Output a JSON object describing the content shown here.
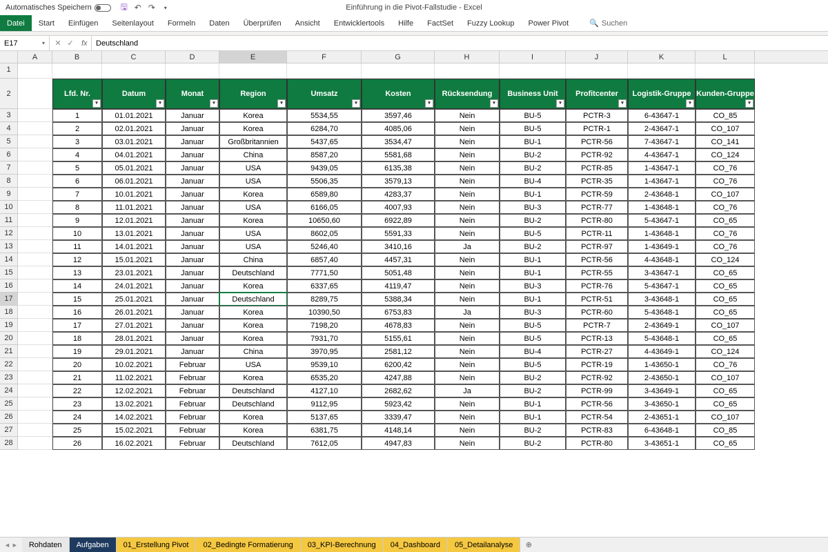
{
  "titlebar": {
    "autosave_label": "Automatisches Speichern",
    "doc_title": "Einführung in die Pivot-Fallstudie - Excel"
  },
  "ribbon": {
    "tabs": [
      "Datei",
      "Start",
      "Einfügen",
      "Seitenlayout",
      "Formeln",
      "Daten",
      "Überprüfen",
      "Ansicht",
      "Entwicklertools",
      "Hilfe",
      "FactSet",
      "Fuzzy Lookup",
      "Power Pivot"
    ],
    "search_placeholder": "Suchen"
  },
  "formula_bar": {
    "name_box": "E17",
    "formula_value": "Deutschland"
  },
  "columns": [
    "A",
    "B",
    "C",
    "D",
    "E",
    "F",
    "G",
    "H",
    "I",
    "J",
    "K",
    "L"
  ],
  "row_numbers": [
    "1",
    "2",
    "3",
    "4",
    "5",
    "6",
    "7",
    "8",
    "9",
    "10",
    "11",
    "12",
    "13",
    "14",
    "15",
    "16",
    "17",
    "18",
    "19",
    "20",
    "21",
    "22",
    "23",
    "24",
    "25",
    "26",
    "27",
    "28"
  ],
  "table": {
    "headers": [
      "Lfd. Nr.",
      "Datum",
      "Monat",
      "Region",
      "Umsatz",
      "Kosten",
      "Rücksendung",
      "Business Unit",
      "Profitcenter",
      "Logistik-Gruppe",
      "Kunden-Gruppe"
    ],
    "rows": [
      [
        "1",
        "01.01.2021",
        "Januar",
        "Korea",
        "5534,55",
        "3597,46",
        "Nein",
        "BU-5",
        "PCTR-3",
        "6-43647-1",
        "CO_85"
      ],
      [
        "2",
        "02.01.2021",
        "Januar",
        "Korea",
        "6284,70",
        "4085,06",
        "Nein",
        "BU-5",
        "PCTR-1",
        "2-43647-1",
        "CO_107"
      ],
      [
        "3",
        "03.01.2021",
        "Januar",
        "Großbritannien",
        "5437,65",
        "3534,47",
        "Nein",
        "BU-1",
        "PCTR-56",
        "7-43647-1",
        "CO_141"
      ],
      [
        "4",
        "04.01.2021",
        "Januar",
        "China",
        "8587,20",
        "5581,68",
        "Nein",
        "BU-2",
        "PCTR-92",
        "4-43647-1",
        "CO_124"
      ],
      [
        "5",
        "05.01.2021",
        "Januar",
        "USA",
        "9439,05",
        "6135,38",
        "Nein",
        "BU-2",
        "PCTR-85",
        "1-43647-1",
        "CO_76"
      ],
      [
        "6",
        "06.01.2021",
        "Januar",
        "USA",
        "5506,35",
        "3579,13",
        "Nein",
        "BU-4",
        "PCTR-35",
        "1-43647-1",
        "CO_76"
      ],
      [
        "7",
        "10.01.2021",
        "Januar",
        "Korea",
        "6589,80",
        "4283,37",
        "Nein",
        "BU-1",
        "PCTR-59",
        "2-43648-1",
        "CO_107"
      ],
      [
        "8",
        "11.01.2021",
        "Januar",
        "USA",
        "6166,05",
        "4007,93",
        "Nein",
        "BU-3",
        "PCTR-77",
        "1-43648-1",
        "CO_76"
      ],
      [
        "9",
        "12.01.2021",
        "Januar",
        "Korea",
        "10650,60",
        "6922,89",
        "Nein",
        "BU-2",
        "PCTR-80",
        "5-43647-1",
        "CO_65"
      ],
      [
        "10",
        "13.01.2021",
        "Januar",
        "USA",
        "8602,05",
        "5591,33",
        "Nein",
        "BU-5",
        "PCTR-11",
        "1-43648-1",
        "CO_76"
      ],
      [
        "11",
        "14.01.2021",
        "Januar",
        "USA",
        "5246,40",
        "3410,16",
        "Ja",
        "BU-2",
        "PCTR-97",
        "1-43649-1",
        "CO_76"
      ],
      [
        "12",
        "15.01.2021",
        "Januar",
        "China",
        "6857,40",
        "4457,31",
        "Nein",
        "BU-1",
        "PCTR-56",
        "4-43648-1",
        "CO_124"
      ],
      [
        "13",
        "23.01.2021",
        "Januar",
        "Deutschland",
        "7771,50",
        "5051,48",
        "Nein",
        "BU-1",
        "PCTR-55",
        "3-43647-1",
        "CO_65"
      ],
      [
        "14",
        "24.01.2021",
        "Januar",
        "Korea",
        "6337,65",
        "4119,47",
        "Nein",
        "BU-3",
        "PCTR-76",
        "5-43647-1",
        "CO_65"
      ],
      [
        "15",
        "25.01.2021",
        "Januar",
        "Deutschland",
        "8289,75",
        "5388,34",
        "Nein",
        "BU-1",
        "PCTR-51",
        "3-43648-1",
        "CO_65"
      ],
      [
        "16",
        "26.01.2021",
        "Januar",
        "Korea",
        "10390,50",
        "6753,83",
        "Ja",
        "BU-3",
        "PCTR-60",
        "5-43648-1",
        "CO_65"
      ],
      [
        "17",
        "27.01.2021",
        "Januar",
        "Korea",
        "7198,20",
        "4678,83",
        "Nein",
        "BU-5",
        "PCTR-7",
        "2-43649-1",
        "CO_107"
      ],
      [
        "18",
        "28.01.2021",
        "Januar",
        "Korea",
        "7931,70",
        "5155,61",
        "Nein",
        "BU-5",
        "PCTR-13",
        "5-43648-1",
        "CO_65"
      ],
      [
        "19",
        "29.01.2021",
        "Januar",
        "China",
        "3970,95",
        "2581,12",
        "Nein",
        "BU-4",
        "PCTR-27",
        "4-43649-1",
        "CO_124"
      ],
      [
        "20",
        "10.02.2021",
        "Februar",
        "USA",
        "9539,10",
        "6200,42",
        "Nein",
        "BU-5",
        "PCTR-19",
        "1-43650-1",
        "CO_76"
      ],
      [
        "21",
        "11.02.2021",
        "Februar",
        "Korea",
        "6535,20",
        "4247,88",
        "Nein",
        "BU-2",
        "PCTR-92",
        "2-43650-1",
        "CO_107"
      ],
      [
        "22",
        "12.02.2021",
        "Februar",
        "Deutschland",
        "4127,10",
        "2682,62",
        "Ja",
        "BU-2",
        "PCTR-99",
        "3-43649-1",
        "CO_65"
      ],
      [
        "23",
        "13.02.2021",
        "Februar",
        "Deutschland",
        "9112,95",
        "5923,42",
        "Nein",
        "BU-1",
        "PCTR-56",
        "3-43650-1",
        "CO_65"
      ],
      [
        "24",
        "14.02.2021",
        "Februar",
        "Korea",
        "5137,65",
        "3339,47",
        "Nein",
        "BU-1",
        "PCTR-54",
        "2-43651-1",
        "CO_107"
      ],
      [
        "25",
        "15.02.2021",
        "Februar",
        "Korea",
        "6381,75",
        "4148,14",
        "Nein",
        "BU-2",
        "PCTR-83",
        "6-43648-1",
        "CO_85"
      ],
      [
        "26",
        "16.02.2021",
        "Februar",
        "Deutschland",
        "7612,05",
        "4947,83",
        "Nein",
        "BU-2",
        "PCTR-80",
        "3-43651-1",
        "CO_65"
      ]
    ]
  },
  "sheets": [
    "Rohdaten",
    "Aufgaben",
    "01_Erstellung Pivot",
    "02_Bedingte Formatierung",
    "03_KPI-Berechnung",
    "04_Dashboard",
    "05_Detailanalyse"
  ],
  "selected_cell": {
    "row": 17,
    "col": "E"
  }
}
